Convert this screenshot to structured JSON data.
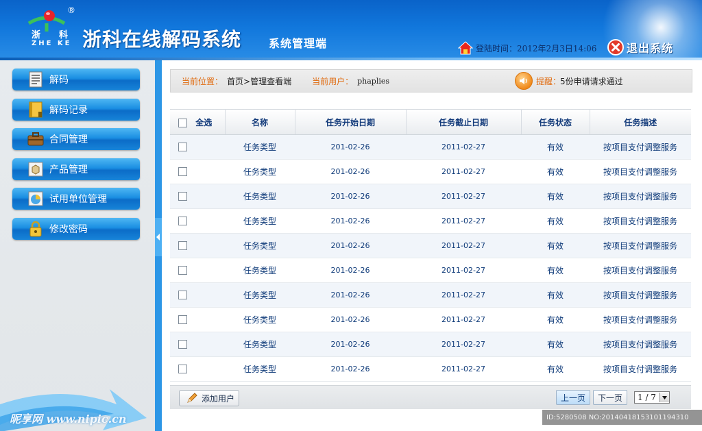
{
  "header": {
    "logo_registered": "®",
    "logo_cn_left": "浙",
    "logo_cn_right": "科",
    "logo_en": "ZHE KE",
    "title": "浙科在线解码系统",
    "subtitle": "系统管理端",
    "login_label": "登陆时间：",
    "login_time": "2012年2月3日14:06",
    "logout_label": "退出系统"
  },
  "sidebar": {
    "items": [
      {
        "label": "解码",
        "icon": "document-icon"
      },
      {
        "label": "解码记录",
        "icon": "notebook-icon"
      },
      {
        "label": "合同管理",
        "icon": "briefcase-icon"
      },
      {
        "label": "产品管理",
        "icon": "box-icon"
      },
      {
        "label": "试用单位管理",
        "icon": "pie-chart-icon"
      },
      {
        "label": "修改密码",
        "icon": "lock-icon"
      }
    ],
    "watermark": "昵享网 www.nipic.cn"
  },
  "location": {
    "current_label": "当前位置：",
    "current_value": "首页>管理查看端",
    "user_label": "当前用户：",
    "user_value": "phaplies",
    "reminder_label": "提醒：",
    "reminder_value": "5份申请请求通过"
  },
  "table": {
    "select_all": "全选",
    "columns": [
      "名称",
      "任务开始日期",
      "任务截止日期",
      "任务状态",
      "任务描述"
    ],
    "rows": [
      [
        "任务类型",
        "201-02-26",
        "2011-02-27",
        "有效",
        "按项目支付调整服务"
      ],
      [
        "任务类型",
        "201-02-26",
        "2011-02-27",
        "有效",
        "按项目支付调整服务"
      ],
      [
        "任务类型",
        "201-02-26",
        "2011-02-27",
        "有效",
        "按项目支付调整服务"
      ],
      [
        "任务类型",
        "201-02-26",
        "2011-02-27",
        "有效",
        "按项目支付调整服务"
      ],
      [
        "任务类型",
        "201-02-26",
        "2011-02-27",
        "有效",
        "按项目支付调整服务"
      ],
      [
        "任务类型",
        "201-02-26",
        "2011-02-27",
        "有效",
        "按项目支付调整服务"
      ],
      [
        "任务类型",
        "201-02-26",
        "2011-02-27",
        "有效",
        "按项目支付调整服务"
      ],
      [
        "任务类型",
        "201-02-26",
        "2011-02-27",
        "有效",
        "按项目支付调整服务"
      ],
      [
        "任务类型",
        "201-02-26",
        "2011-02-27",
        "有效",
        "按项目支付调整服务"
      ],
      [
        "任务类型",
        "201-02-26",
        "2011-02-27",
        "有效",
        "按项目支付调整服务"
      ]
    ]
  },
  "footer": {
    "add_user": "添加用户",
    "prev_page": "上一页",
    "next_page": "下一页",
    "page_select": "1 / 7"
  },
  "image_id_mark": "ID:5280508 NO:20140418153101194310",
  "colors": {
    "header_blue": "#1177dc",
    "sidebar_button_blue": "#1a8ee2",
    "location_key_orange": "#e06a0e",
    "table_text_blue": "#0d3978"
  }
}
